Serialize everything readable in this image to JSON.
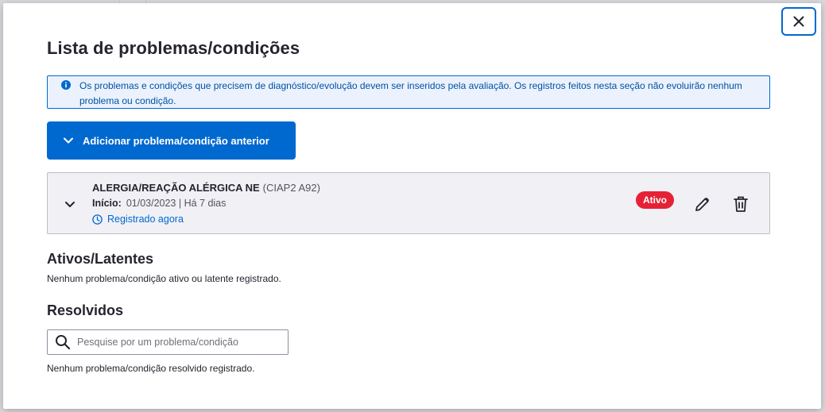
{
  "modal": {
    "title": "Lista de problemas/condições",
    "close_icon": "close-icon",
    "info": {
      "icon": "info-icon",
      "text": "Os problemas e condições que precisem de diagnóstico/evolução devem ser inseridos pela avaliação. Os registros feitos nesta seção não evoluirão nenhum problema ou condição."
    },
    "add_button": {
      "icon": "chevron-down-icon",
      "label": "Adicionar problema/condição anterior"
    },
    "problem": {
      "name": "ALERGIA/REAÇÃO ALÉRGICA NE",
      "code": "(CIAP2 A92)",
      "start_label": "Início:",
      "start_value": "01/03/2023 | Há 7 dias",
      "registered": "Registrado agora",
      "status": "Ativo",
      "status_color": "#e52136"
    },
    "active_section": {
      "title": "Ativos/Latentes",
      "empty_text": "Nenhum problema/condição ativo ou latente registrado."
    },
    "resolved_section": {
      "title": "Resolvidos",
      "search_placeholder": "Pesquise por um problema/condição",
      "empty_text": "Nenhum problema/condição resolvido registrado."
    }
  },
  "colors": {
    "primary": "#0069d0",
    "info_bg": "#ebf2fd",
    "card_bg": "#f0f0f5",
    "danger": "#e52136"
  }
}
